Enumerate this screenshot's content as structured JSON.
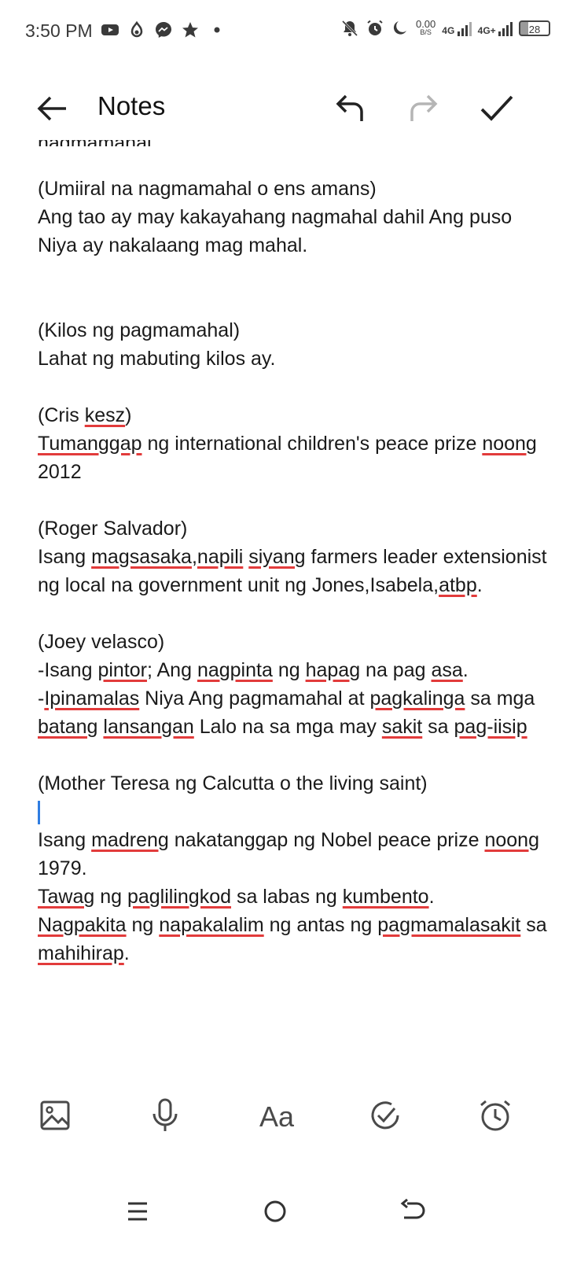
{
  "status_bar": {
    "time": "3:50 PM",
    "left_icons": [
      "youtube-icon",
      "app-icon",
      "messenger-icon",
      "star-icon",
      "dot-icon"
    ],
    "right_icons": [
      "mute-icon",
      "alarm-icon",
      "moon-icon"
    ],
    "net_speed_value": "0.00",
    "net_speed_unit": "B/S",
    "signal_1": "4G",
    "signal_2": "4G+",
    "battery": "28"
  },
  "toolbar": {
    "title": "Notes",
    "icons": [
      "back-arrow-icon",
      "undo-icon",
      "redo-icon",
      "check-icon"
    ]
  },
  "note": {
    "clipped_line": "nagmamahal",
    "lines": [
      "(Umiiral na nagmamahal o ens amans)",
      "Ang tao ay may kakayahang nagmahal dahil Ang puso Niya ay nakalaang  mag mahal.",
      "(Kilos ng pagmamahal)",
      "Lahat ng mabuting kilos ay.",
      "(Cris ",
      "kesz",
      ")",
      "Tumanggap",
      " ng international children's peace prize ",
      "noong",
      " 2012",
      "(Roger Salvador)",
      "Isang ",
      "magsasaka",
      ",",
      "napili",
      " ",
      "siyang",
      " farmers leader extensionist ng local na government unit ng Jones,Isabela,",
      "atbp",
      ".",
      "(Joey velasco)",
      "-Isang ",
      "pintor",
      "; Ang ",
      "nagpinta",
      " ng ",
      "hapag",
      " na pag ",
      "asa",
      ".",
      "-",
      "Ipinamalas",
      " Niya Ang pagmamahal at ",
      "pagkalinga",
      " sa mga ",
      "batang",
      " ",
      "lansangan",
      " Lalo na sa mga may ",
      "sakit",
      " sa ",
      "pag-iisip",
      "(Mother Teresa ng Calcutta o the living saint)",
      "Isang ",
      "madreng",
      " nakatanggap ng Nobel peace prize ",
      "noong",
      " 1979.",
      "Tawag",
      " ng ",
      "paglilingkod",
      " sa labas ng ",
      "kumbento",
      ".",
      "Nagpakita",
      " ng ",
      "napakalalim",
      " ng antas ng ",
      "pagmamalasakit",
      " sa ",
      "mahihirap",
      "."
    ]
  },
  "edit_bar": {
    "font_label": "Aa",
    "icons": [
      "image-icon",
      "microphone-icon",
      "font-icon",
      "checklist-icon",
      "reminder-icon"
    ]
  },
  "nav_bar": {
    "icons": [
      "menu-icon",
      "home-icon",
      "back-icon"
    ]
  },
  "colors": {
    "spellcheck_underline": "#e23b3b",
    "cursor": "#2f7de1",
    "disabled_icon": "#b5b5b5"
  }
}
